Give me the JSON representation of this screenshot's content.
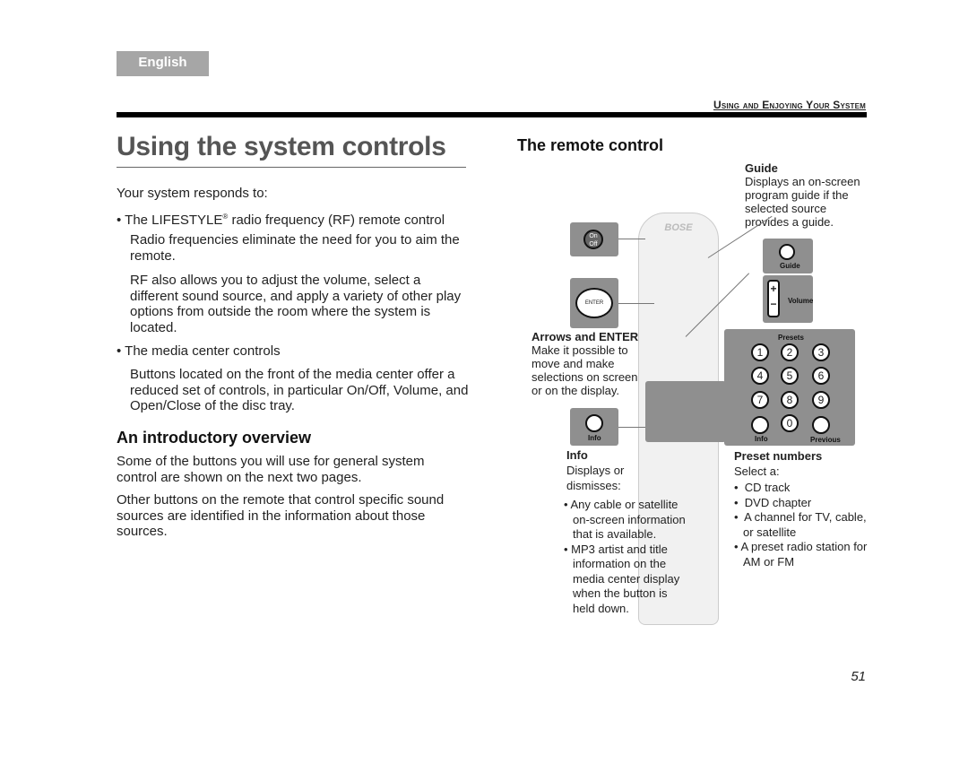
{
  "header": {
    "language_tab": "English",
    "running_head": "Using and Enjoying Your System",
    "page_number": "51"
  },
  "left": {
    "title": "Using the system controls",
    "intro": "Your system responds to:",
    "bullet1": "The LIFESTYLE",
    "bullet1_reg": "®",
    "bullet1_rest": " radio frequency (RF) remote control",
    "para1": "Radio frequencies eliminate the need for you to aim the remote.",
    "para2": "RF also allows you to adjust the volume, select a different sound source, and apply a variety of other play options from outside the room where the system is located.",
    "bullet2": "The media center controls",
    "para3": "Buttons located on the front of the media center offer a reduced set of controls, in particular On/Off, Volume, and Open/Close of the disc tray.",
    "overview_heading": "An introductory overview",
    "overview_p1": "Some of the buttons you will use for general system control are shown on the next two pages.",
    "overview_p2": "Other buttons on the remote that control specific sound sources are identified in the information about those sources."
  },
  "right": {
    "heading": "The remote control",
    "guide": {
      "title": "Guide",
      "text": "Displays an on-screen program guide if the selected source provides a guide."
    },
    "arrows": {
      "title": "Arrows and ENTER",
      "text": "Make it possible to move and make selections on screen or on the display."
    },
    "info": {
      "title": "Info",
      "text": "Displays or dismisses:",
      "items": [
        "Any cable or satellite on-screen information that is available.",
        "MP3 artist and title information on the media center display when the button is held down."
      ]
    },
    "presets": {
      "title": "Preset numbers",
      "text": "Select a:",
      "items": [
        "CD track",
        "DVD chapter",
        "A channel for TV, cable, or satellite",
        "A preset radio station for AM or FM"
      ]
    },
    "illustration": {
      "brand": "BOSE",
      "on_off": "On Off",
      "enter": "ENTER",
      "guide_label": "Guide",
      "volume_label": "Volume",
      "presets_label": "Presets",
      "info_label": "Info",
      "previous_label": "Previous",
      "digits": [
        "1",
        "2",
        "3",
        "4",
        "5",
        "6",
        "7",
        "8",
        "9",
        "0"
      ]
    }
  }
}
